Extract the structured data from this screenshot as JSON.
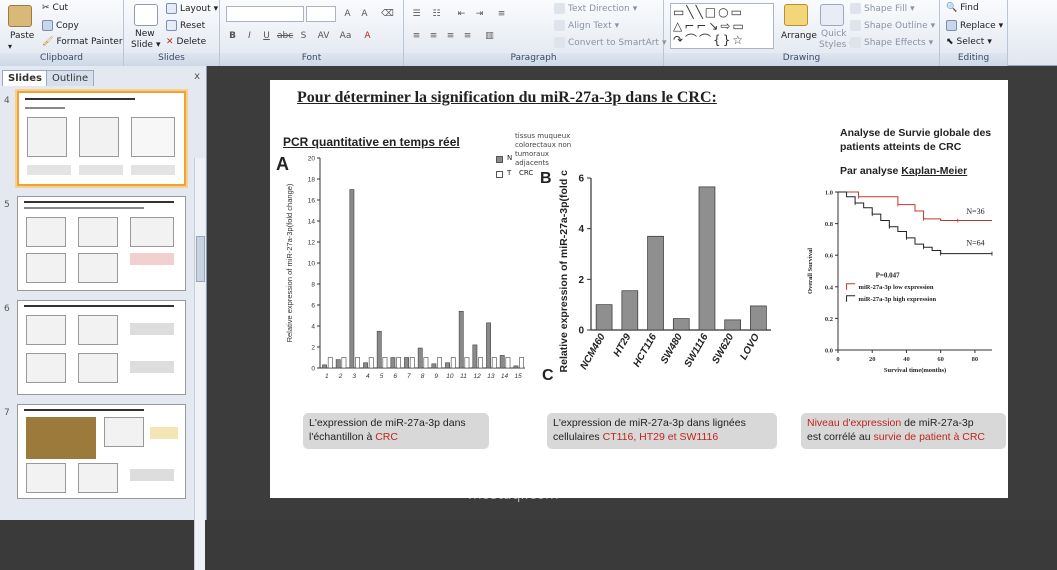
{
  "ribbon": {
    "clipboard": {
      "label": "Clipboard",
      "paste": "Paste",
      "cut": "Cut",
      "copy": "Copy",
      "format_painter": "Format Painter"
    },
    "slides": {
      "label": "Slides",
      "new_slide": "New",
      "new_slide2": "Slide",
      "layout": "Layout",
      "reset": "Reset",
      "delete": "Delete"
    },
    "font": {
      "label": "Font"
    },
    "paragraph": {
      "label": "Paragraph",
      "text_direction": "Text Direction",
      "align_text": "Align Text",
      "convert_smartart": "Convert to SmartArt"
    },
    "drawing": {
      "label": "Drawing",
      "arrange": "Arrange",
      "quick_styles": "Quick",
      "quick_styles2": "Styles",
      "shape_fill": "Shape Fill",
      "shape_outline": "Shape Outline",
      "shape_effects": "Shape Effects"
    },
    "editing": {
      "label": "Editing",
      "find": "Find",
      "replace": "Replace",
      "select": "Select"
    }
  },
  "panel": {
    "tab_slides": "Slides",
    "tab_outline": "Outline",
    "close": "x",
    "slide_numbers": [
      "4",
      "5",
      "6",
      "7"
    ]
  },
  "slide": {
    "title": "Pour déterminer la signification du miR-27a-3p dans le CRC:",
    "pcr_heading": "PCR quantitative en temps réel",
    "panel_a": "A",
    "panel_b": "B",
    "panel_c": "C",
    "legend_header": [
      "tissus muqueux",
      "colorectaux non",
      "tumoraux",
      "adjacents"
    ],
    "legend_n_key": "N",
    "legend_t_key": "T",
    "legend_t_label": "CRC",
    "survival_title_1": "Analyse de Survie globale des",
    "survival_title_2": "patients atteints de CRC",
    "km_prefix": "Par analyse ",
    "km_name": "Kaplan-Meier",
    "caption_a_1": "L'expression de miR-27a-3p dans",
    "caption_a_2": "l'échantillon à ",
    "caption_a_red": "CRC",
    "caption_b_1": "L'expression de miR-27a-3p dans lignées",
    "caption_b_2": "cellulaires ",
    "caption_b_red": "CT116, HT29 et SW1116",
    "caption_c_red1": "Niveau d'expression",
    "caption_c_1": " de miR-27a-3p",
    "caption_c_2": "est corrélé au ",
    "caption_c_red2": "survie de patient à CRC"
  },
  "chart_data": [
    {
      "type": "bar",
      "ylabel": "Relative expression of miR-27a-3p(fold change)",
      "categories": [
        "1",
        "2",
        "3",
        "4",
        "5",
        "6",
        "7",
        "8",
        "9",
        "10",
        "11",
        "12",
        "13",
        "14",
        "15"
      ],
      "ylim": [
        0,
        20
      ],
      "yticks": [
        "0",
        "2",
        "4",
        "6",
        "8",
        "10",
        "12",
        "14",
        "16",
        "18",
        "20"
      ],
      "series": [
        {
          "name": "N",
          "values": [
            0.3,
            0.8,
            17.0,
            0.5,
            3.5,
            1.0,
            1.0,
            1.9,
            0.4,
            0.5,
            5.4,
            2.2,
            4.3,
            1.2,
            0.2
          ]
        },
        {
          "name": "T",
          "values": [
            1.0,
            1.0,
            1.0,
            1.0,
            1.0,
            1.0,
            1.0,
            1.0,
            1.0,
            1.0,
            1.0,
            1.0,
            1.0,
            1.0,
            1.0
          ]
        }
      ]
    },
    {
      "type": "bar",
      "ylabel": "Relative expression of miR-27a-3p(fold change)",
      "categories": [
        "NCM460",
        "HT29",
        "HCT116",
        "SW480",
        "SW1116",
        "SW620",
        "LOVO"
      ],
      "values": [
        1.0,
        1.55,
        3.7,
        0.45,
        5.65,
        0.4,
        0.95
      ],
      "ylim": [
        0,
        6
      ],
      "yticks": [
        "0",
        "2",
        "4",
        "6"
      ]
    },
    {
      "type": "line",
      "xlabel": "Survival time(months)",
      "ylabel": "Overall Survival",
      "xlim": [
        0,
        90
      ],
      "ylim": [
        0,
        1.0
      ],
      "xticks": [
        "0",
        "20",
        "40",
        "60",
        "80"
      ],
      "yticks": [
        "0.0",
        "0.2",
        "0.4",
        "0.6",
        "0.8",
        "1.0"
      ],
      "annotations": [
        "N=36",
        "N=64",
        "P=0.047"
      ],
      "series": [
        {
          "name": "miR-27a-3p low expression",
          "color": "#c0392b",
          "x": [
            0,
            6,
            12,
            25,
            35,
            45,
            50,
            60,
            70,
            90
          ],
          "y": [
            1.0,
            1.0,
            0.97,
            0.97,
            0.92,
            0.88,
            0.83,
            0.82,
            0.82,
            0.82
          ]
        },
        {
          "name": "miR-27a-3p high expression",
          "color": "#222222",
          "x": [
            0,
            5,
            10,
            15,
            20,
            25,
            30,
            35,
            40,
            45,
            50,
            55,
            60,
            70,
            90
          ],
          "y": [
            1.0,
            0.97,
            0.93,
            0.9,
            0.86,
            0.82,
            0.78,
            0.75,
            0.71,
            0.67,
            0.65,
            0.63,
            0.61,
            0.61,
            0.61
          ]
        }
      ]
    }
  ]
}
